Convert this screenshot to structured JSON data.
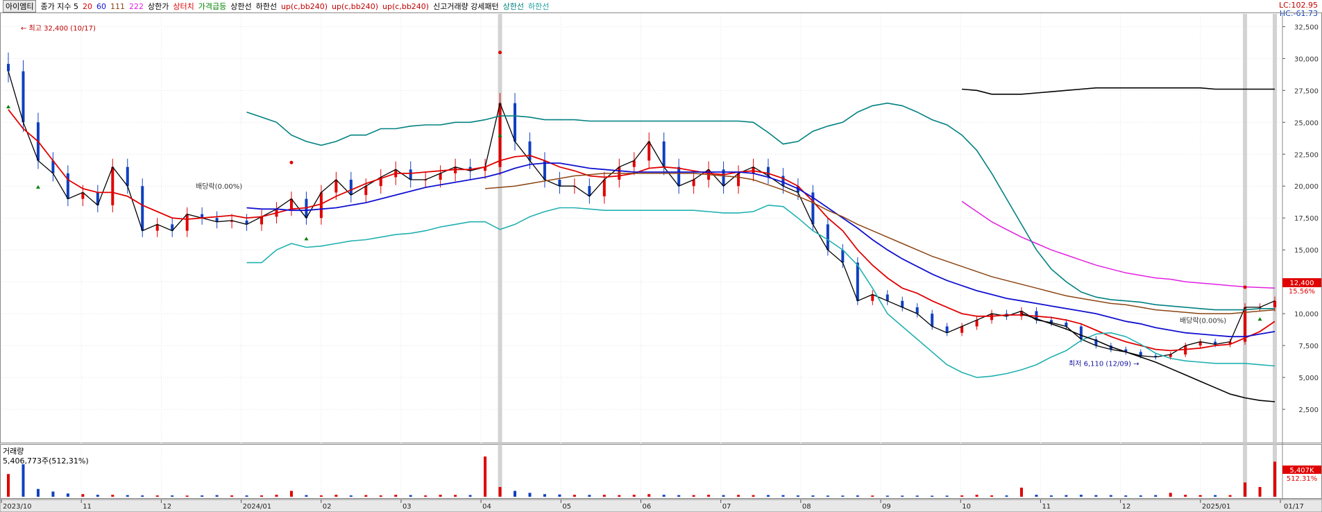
{
  "legend": {
    "ticker": "아이엠티",
    "close_label": "종가 지수 5",
    "ma20": "20",
    "ma60": "60",
    "ma111": "111",
    "ma222": "222",
    "upper_limit": "상한가",
    "upper_touch": "상터치",
    "price_jump": "가격급등",
    "band_upper": "상한선",
    "band_lower": "하한선",
    "up1": "up(c,bb240)",
    "up2": "up(c,bb240)",
    "up3": "up(c,bb240)",
    "new_high_vol": "신고거래량 강세패턴",
    "band_upper2": "상한선",
    "band_lower2": "하한선"
  },
  "top_right": {
    "lc": "LC:102.95",
    "hc": "HC:-61.73"
  },
  "colors": {
    "up_candle": "#e00000",
    "down_candle": "#1040c0",
    "ma5": "#000000",
    "ma20": "#e00000",
    "ma60": "#1010d0",
    "ma111": "#8b4513",
    "ma222": "#e020e0",
    "bb_upper": "#008080",
    "bb_lower": "#20b0b0",
    "bb_long": "#000000"
  },
  "chart_data": {
    "type": "line",
    "title": "아이엠티",
    "price_axis_ticks": [
      "32,500",
      "30,000",
      "27,500",
      "25,000",
      "22,500",
      "20,000",
      "17,500",
      "15,000",
      "12,500",
      "10,000",
      "7,500",
      "5,000",
      "2,500"
    ],
    "ylim": [
      0,
      33500
    ],
    "x_ticks": [
      "2023/10",
      "11",
      "12",
      "2024/01",
      "02",
      "03",
      "04",
      "05",
      "06",
      "07",
      "08",
      "09",
      "10",
      "11",
      "12",
      "2025/01",
      "01/17"
    ],
    "annotations": {
      "high": "최고 32,400 (10/17)",
      "low": "최저 6,110 (12/09)",
      "dividend1": "배당락(0.00%)",
      "dividend2": "배당락(0.00%)"
    },
    "last_price_label": "12,400",
    "last_change_label": "15.56%",
    "series": [
      {
        "name": "5",
        "values": [
          29000,
          25000,
          22000,
          21000,
          19000,
          19500,
          18500,
          21500,
          20000,
          16500,
          17000,
          16500,
          17800,
          17500,
          17200,
          17300,
          17000,
          17600,
          18200,
          19000,
          17500,
          19500,
          20500,
          19300,
          20000,
          20700,
          21300,
          20500,
          20500,
          21000,
          21500,
          21200,
          21500,
          26500,
          23500,
          22000,
          20500,
          20000,
          20000,
          19200,
          20500,
          21500,
          22000,
          23500,
          21500,
          20000,
          20500,
          21300,
          20000,
          21000,
          21500,
          20800,
          20000,
          19500,
          17000,
          15000,
          14000,
          11000,
          11500,
          11000,
          10500,
          10000,
          9000,
          8500,
          9000,
          9500,
          10000,
          9800,
          10200,
          9500,
          9300,
          9000,
          8000,
          7500,
          7200,
          7000,
          6700,
          6600,
          6800,
          7500,
          7800,
          7600,
          7800,
          10500,
          10500,
          11000
        ]
      },
      {
        "name": "20",
        "values": [
          26000,
          24500,
          23500,
          22000,
          20500,
          19800,
          19500,
          19500,
          19200,
          18500,
          18000,
          17500,
          17400,
          17500,
          17600,
          17700,
          17500,
          17600,
          17900,
          18200,
          18300,
          18600,
          19200,
          19700,
          20200,
          20600,
          21000,
          21000,
          21100,
          21200,
          21300,
          21300,
          21500,
          22000,
          22300,
          22400,
          22000,
          21500,
          21200,
          20800,
          20700,
          20800,
          21000,
          21400,
          21500,
          21400,
          21200,
          21000,
          20900,
          21100,
          21200,
          21000,
          20600,
          20000,
          18800,
          17500,
          16500,
          15000,
          13800,
          12800,
          12000,
          11600,
          11000,
          10500,
          10000,
          9800,
          9800,
          9900,
          9900,
          9800,
          9700,
          9500,
          9200,
          8700,
          8200,
          7800,
          7500,
          7200,
          7100,
          7200,
          7300,
          7500,
          7600,
          8100,
          8600,
          9400
        ]
      },
      {
        "name": "60",
        "values": [
          null,
          null,
          null,
          null,
          null,
          null,
          null,
          null,
          null,
          null,
          null,
          null,
          null,
          null,
          null,
          null,
          18300,
          18200,
          18200,
          18100,
          18100,
          18200,
          18300,
          18500,
          18700,
          19000,
          19300,
          19600,
          19900,
          20100,
          20300,
          20500,
          20700,
          21000,
          21400,
          21700,
          21800,
          21800,
          21600,
          21400,
          21300,
          21200,
          21100,
          21100,
          21100,
          21100,
          21100,
          21100,
          21100,
          21100,
          21000,
          20700,
          20300,
          19800,
          19100,
          18300,
          17500,
          16700,
          15800,
          15000,
          14300,
          13700,
          13100,
          12600,
          12200,
          11800,
          11500,
          11200,
          11000,
          10800,
          10600,
          10400,
          10200,
          10000,
          9700,
          9400,
          9200,
          8900,
          8700,
          8500,
          8400,
          8300,
          8200,
          8200,
          8400,
          8600
        ]
      },
      {
        "name": "111",
        "values": [
          null,
          null,
          null,
          null,
          null,
          null,
          null,
          null,
          null,
          null,
          null,
          null,
          null,
          null,
          null,
          null,
          null,
          null,
          null,
          null,
          null,
          null,
          null,
          null,
          null,
          null,
          null,
          null,
          null,
          null,
          null,
          null,
          19800,
          19900,
          20000,
          20200,
          20400,
          20600,
          20800,
          20900,
          21000,
          21000,
          21000,
          21000,
          21000,
          21000,
          21000,
          20900,
          20800,
          20700,
          20500,
          20100,
          19700,
          19200,
          18700,
          18100,
          17600,
          17000,
          16500,
          16000,
          15500,
          15000,
          14500,
          14100,
          13700,
          13300,
          12900,
          12600,
          12300,
          12000,
          11700,
          11400,
          11200,
          11000,
          10800,
          10700,
          10500,
          10300,
          10200,
          10100,
          10000,
          10000,
          10000,
          10100,
          10200,
          10300
        ]
      },
      {
        "name": "222",
        "values": [
          null,
          null,
          null,
          null,
          null,
          null,
          null,
          null,
          null,
          null,
          null,
          null,
          null,
          null,
          null,
          null,
          null,
          null,
          null,
          null,
          null,
          null,
          null,
          null,
          null,
          null,
          null,
          null,
          null,
          null,
          null,
          null,
          null,
          null,
          null,
          null,
          null,
          null,
          null,
          null,
          null,
          null,
          null,
          null,
          null,
          null,
          null,
          null,
          null,
          null,
          null,
          null,
          null,
          null,
          null,
          null,
          null,
          null,
          null,
          null,
          null,
          null,
          null,
          null,
          18800,
          18000,
          17200,
          16600,
          16000,
          15500,
          15000,
          14600,
          14200,
          13800,
          13500,
          13200,
          13000,
          12800,
          12700,
          12500,
          12400,
          12300,
          12200,
          12100,
          12050,
          12000
        ]
      },
      {
        "name": "상한선",
        "values": [
          null,
          null,
          null,
          null,
          null,
          null,
          null,
          null,
          null,
          null,
          null,
          null,
          null,
          null,
          null,
          null,
          25800,
          25400,
          25000,
          24000,
          23500,
          23200,
          23500,
          24000,
          24000,
          24500,
          24500,
          24700,
          24800,
          24800,
          25000,
          25000,
          25200,
          25500,
          25500,
          25400,
          25200,
          25200,
          25200,
          25100,
          25100,
          25100,
          25100,
          25100,
          25100,
          25100,
          25100,
          25100,
          25100,
          25100,
          25000,
          24200,
          23300,
          23500,
          24300,
          24700,
          25000,
          25800,
          26300,
          26500,
          26300,
          25800,
          25200,
          24800,
          24000,
          22800,
          21000,
          19000,
          17000,
          15000,
          13500,
          12500,
          11700,
          11300,
          11100,
          11000,
          10900,
          10700,
          10600,
          10500,
          10400,
          10300,
          10300,
          10300,
          10400,
          10400
        ]
      },
      {
        "name": "하한선",
        "values": [
          null,
          null,
          null,
          null,
          null,
          null,
          null,
          null,
          null,
          null,
          null,
          null,
          null,
          null,
          null,
          null,
          14000,
          14000,
          15000,
          15500,
          15200,
          15300,
          15500,
          15700,
          15800,
          16000,
          16200,
          16300,
          16500,
          16800,
          17000,
          17200,
          17200,
          16600,
          17000,
          17600,
          18000,
          18300,
          18300,
          18200,
          18100,
          18100,
          18100,
          18100,
          18100,
          18100,
          18100,
          18000,
          17900,
          17900,
          18000,
          18500,
          18400,
          17500,
          16500,
          15800,
          15000,
          13800,
          12000,
          10000,
          9000,
          8000,
          7000,
          6000,
          5400,
          5000,
          5100,
          5300,
          5600,
          6000,
          6600,
          7100,
          7900,
          8400,
          8500,
          8200,
          7600,
          6900,
          6500,
          6300,
          6200,
          6100,
          6100,
          6100,
          6000,
          5900
        ]
      },
      {
        "name": "up(c,bb240)",
        "values": [
          null,
          null,
          null,
          null,
          null,
          null,
          null,
          null,
          null,
          null,
          null,
          null,
          null,
          null,
          null,
          null,
          null,
          null,
          null,
          null,
          null,
          null,
          null,
          null,
          null,
          null,
          null,
          null,
          null,
          null,
          null,
          null,
          null,
          null,
          null,
          null,
          null,
          null,
          null,
          null,
          null,
          null,
          null,
          null,
          null,
          null,
          null,
          null,
          null,
          null,
          null,
          null,
          null,
          null,
          null,
          null,
          null,
          null,
          null,
          null,
          null,
          null,
          null,
          null,
          27600,
          27500,
          27200,
          27200,
          27200,
          27300,
          27400,
          27500,
          27600,
          27700,
          27700,
          27700,
          27700,
          27700,
          27700,
          27700,
          27700,
          27600,
          27600,
          27600,
          27600,
          27600
        ]
      },
      {
        "name": "bb-lower-long",
        "values": [
          null,
          null,
          null,
          null,
          null,
          null,
          null,
          null,
          null,
          null,
          null,
          null,
          null,
          null,
          null,
          null,
          null,
          null,
          null,
          null,
          null,
          null,
          null,
          null,
          null,
          null,
          null,
          null,
          null,
          null,
          null,
          null,
          null,
          null,
          null,
          null,
          null,
          null,
          null,
          null,
          null,
          null,
          null,
          null,
          null,
          null,
          null,
          null,
          null,
          null,
          null,
          null,
          null,
          null,
          null,
          null,
          null,
          null,
          null,
          null,
          null,
          null,
          null,
          null,
          null,
          null,
          null,
          null,
          10000,
          9600,
          9200,
          8800,
          8300,
          7900,
          7400,
          7000,
          6600,
          6200,
          5700,
          5200,
          4700,
          4200,
          3700,
          3400,
          3200,
          3100
        ]
      }
    ],
    "volume": {
      "title": "거래량",
      "info": "5,406,773주(512,31%)",
      "last_label": "5,407K",
      "last_pct": "512.31%",
      "values": [
        3500,
        5000,
        1200,
        800,
        500,
        400,
        300,
        300,
        250,
        200,
        200,
        200,
        180,
        200,
        250,
        200,
        200,
        200,
        300,
        900,
        250,
        200,
        300,
        200,
        250,
        200,
        300,
        250,
        200,
        300,
        280,
        260,
        6200,
        1500,
        900,
        600,
        400,
        350,
        300,
        280,
        300,
        250,
        300,
        400,
        300,
        250,
        250,
        300,
        250,
        280,
        250,
        260,
        250,
        200,
        200,
        180,
        180,
        200,
        180,
        170,
        170,
        180,
        160,
        170,
        200,
        300,
        200,
        200,
        1400,
        300,
        200,
        250,
        300,
        250,
        250,
        200,
        200,
        250,
        600,
        300,
        250,
        250,
        250,
        2200,
        1500,
        5407
      ]
    }
  }
}
